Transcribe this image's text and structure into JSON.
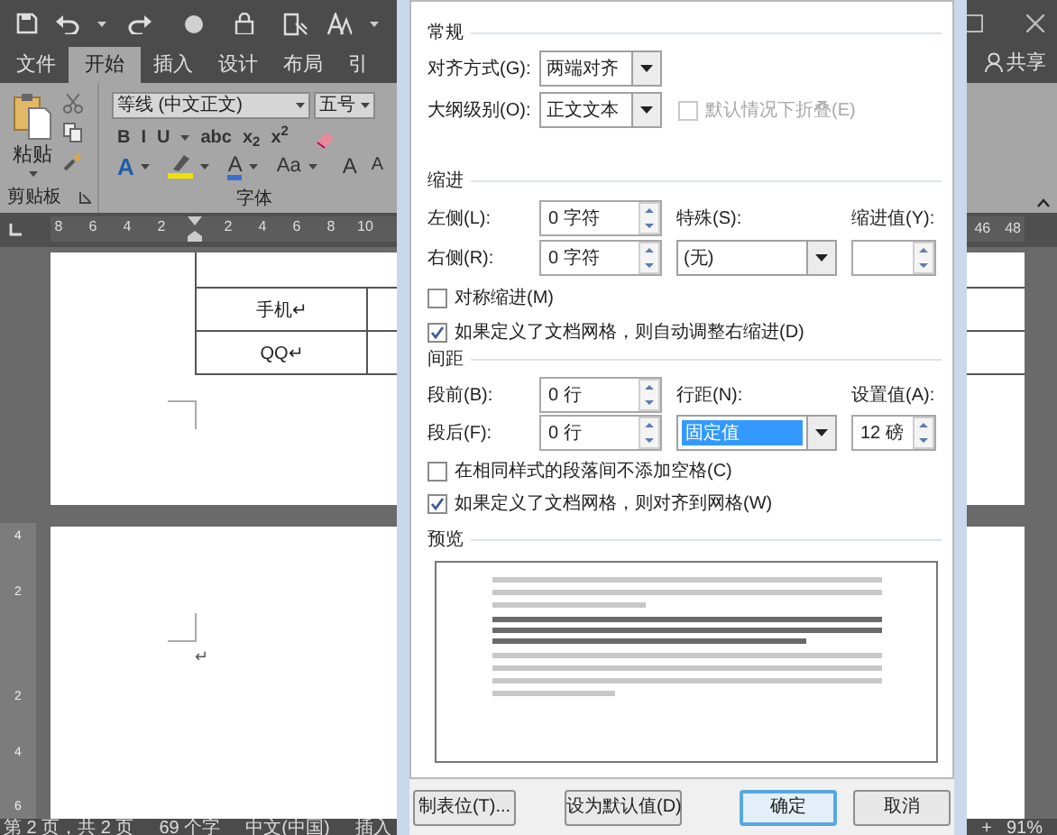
{
  "ribbon_tabs": [
    {
      "label": "文件",
      "selected": false
    },
    {
      "label": "开始",
      "selected": true
    },
    {
      "label": "插入",
      "selected": false
    },
    {
      "label": "设计",
      "selected": false
    },
    {
      "label": "布局",
      "selected": false
    },
    {
      "label": "引",
      "selected": false
    }
  ],
  "share_button": "共享",
  "clipboard_group": {
    "paste_label": "粘贴",
    "group_label": "剪贴板"
  },
  "font_group": {
    "font_name": "等线 (中文正文)",
    "font_size": "五号",
    "group_label": "字体",
    "style_buttons": [
      {
        "kind": "text",
        "text": "B",
        "has_menu": false
      },
      {
        "kind": "text",
        "text": "I",
        "has_menu": false
      },
      {
        "kind": "text",
        "text": "U",
        "has_menu": true
      },
      {
        "kind": "text",
        "text": "abc",
        "has_menu": false
      },
      {
        "kind": "text",
        "text": "x$_{2}$",
        "has_menu": false
      },
      {
        "kind": "text",
        "text": "x$^{2}$",
        "has_menu": false
      },
      {
        "kind": "eraser",
        "has_menu": false
      }
    ],
    "effect_buttons": [
      {
        "kind": "effect",
        "text": "A",
        "has_menu": true
      },
      {
        "kind": "highlight",
        "has_menu": true
      },
      {
        "kind": "color",
        "text": "A",
        "has_menu": true
      },
      {
        "kind": "text",
        "text": "Aa",
        "has_menu": true
      },
      {
        "kind": "grow",
        "text": "A",
        "has_menu": false
      },
      {
        "kind": "shrink",
        "text": "A",
        "has_menu": false
      }
    ]
  },
  "ruler": {
    "left_ticks": [
      "8",
      "6",
      "4",
      "2"
    ],
    "right_ticks": [
      "2",
      "4",
      "6",
      "8",
      "10"
    ],
    "far_ticks": [
      "46",
      "48"
    ]
  },
  "vertical_ruler": [
    "4",
    "2",
    "2",
    "4",
    "6"
  ],
  "document": {
    "table_cells": [
      "手机↵",
      "QQ↵"
    ],
    "paragraph_mark": "↵"
  },
  "status_bar": {
    "items": [
      "第 2 页，共 2 页",
      "69 个字",
      "中文(中国)",
      "插入"
    ],
    "zoom_in": "+",
    "zoom": "91%"
  },
  "dialog": {
    "general": {
      "heading": "常规",
      "alignment": {
        "label": "对齐方式(G):",
        "value": "两端对齐"
      },
      "outline_level": {
        "label": "大纲级别(O):",
        "value": "正文文本"
      },
      "collapse": {
        "label": "默认情况下折叠(E)",
        "checked": false,
        "disabled": true
      }
    },
    "indentation": {
      "heading": "缩进",
      "left": {
        "label": "左侧(L):",
        "value": "0 字符"
      },
      "right": {
        "label": "右侧(R):",
        "value": "0 字符"
      },
      "special": {
        "label": "特殊(S):",
        "value": "(无)"
      },
      "by": {
        "label": "缩进值(Y):"
      },
      "checkboxes": [
        {
          "label": "对称缩进(M)",
          "checked": false
        },
        {
          "label": "如果定义了文档网格，则自动调整右缩进(D)",
          "checked": true
        }
      ]
    },
    "spacing": {
      "heading": "间距",
      "before": {
        "label": "段前(B):",
        "value": "0 行"
      },
      "after": {
        "label": "段后(F):",
        "value": "0 行"
      },
      "line_spacing": {
        "label": "行距(N):",
        "value": "固定值",
        "selected": true
      },
      "at": {
        "label": "设置值(A):",
        "value": "12 磅"
      },
      "checkboxes": [
        {
          "label": "在相同样式的段落间不添加空格(C)",
          "checked": false
        },
        {
          "label": "如果定义了文档网格，则对齐到网格(W)",
          "checked": true
        }
      ]
    },
    "preview": {
      "heading": "预览"
    },
    "buttons": [
      {
        "label": "制表位(T)...",
        "default": false
      },
      {
        "label": "设为默认值(D)",
        "default": false
      },
      {
        "label": "确定",
        "default": true
      },
      {
        "label": "取消",
        "default": false
      }
    ]
  }
}
